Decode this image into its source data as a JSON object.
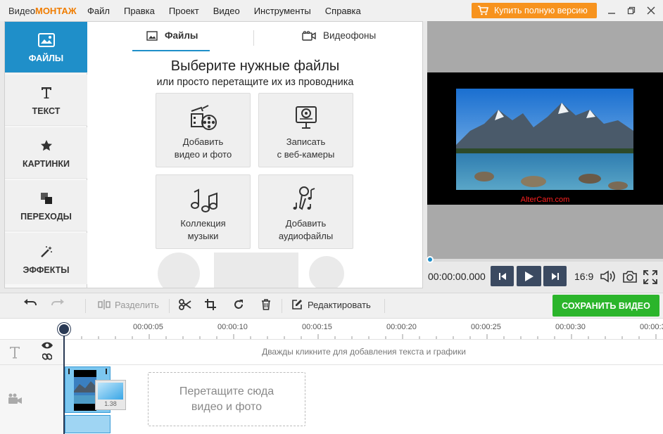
{
  "app": {
    "logo_prefix": "Видео",
    "logo_brand": "МОНТАЖ",
    "buy_label": "Купить полную версию"
  },
  "menu": [
    "Файл",
    "Правка",
    "Проект",
    "Видео",
    "Инструменты",
    "Справка"
  ],
  "sidebar": {
    "items": [
      {
        "label": "ФАЙЛЫ",
        "icon": "image-icon",
        "active": true
      },
      {
        "label": "ТЕКСТ",
        "icon": "text-icon"
      },
      {
        "label": "КАРТИНКИ",
        "icon": "star-icon"
      },
      {
        "label": "ПЕРЕХОДЫ",
        "icon": "transitions-icon"
      },
      {
        "label": "ЭФФЕКТЫ",
        "icon": "magic-wand-icon"
      }
    ]
  },
  "files_panel": {
    "tabs": [
      {
        "label": "Файлы",
        "icon": "image-icon",
        "active": true
      },
      {
        "label": "Видеофоны",
        "icon": "camera-icon"
      }
    ],
    "heading": "Выберите нужные файлы",
    "subheading": "или просто перетащите их из проводника",
    "cards": [
      {
        "line1": "Добавить",
        "line2": "видео и фото",
        "icon": "film-icon"
      },
      {
        "line1": "Записать",
        "line2": "с веб-камеры",
        "icon": "webcam-icon"
      },
      {
        "line1": "Коллекция",
        "line2": "музыки",
        "icon": "music-notes-icon"
      },
      {
        "line1": "Добавить",
        "line2": "аудиофайлы",
        "icon": "microphone-icon"
      }
    ]
  },
  "preview": {
    "watermark": "AlterCam.com",
    "timecode": "00:00:00.000",
    "aspect_ratio": "16:9",
    "progress": 0
  },
  "toolbar": {
    "split_label": "Разделить",
    "edit_label": "Редактировать",
    "save_label": "СОХРАНИТЬ ВИДЕО"
  },
  "timeline": {
    "ticks": [
      "00:00:05",
      "00:00:10",
      "00:00:15",
      "00:00:20",
      "00:00:25",
      "00:00:30",
      "00:00:3"
    ],
    "text_track_hint": "Дважды кликните для добавления текста и графики",
    "clip_duration": "1.38",
    "dropzone_line1": "Перетащите сюда",
    "dropzone_line2": "видео и фото"
  },
  "colors": {
    "accent": "#1f8fc9",
    "buy": "#f7931e",
    "save": "#2bb52b"
  }
}
